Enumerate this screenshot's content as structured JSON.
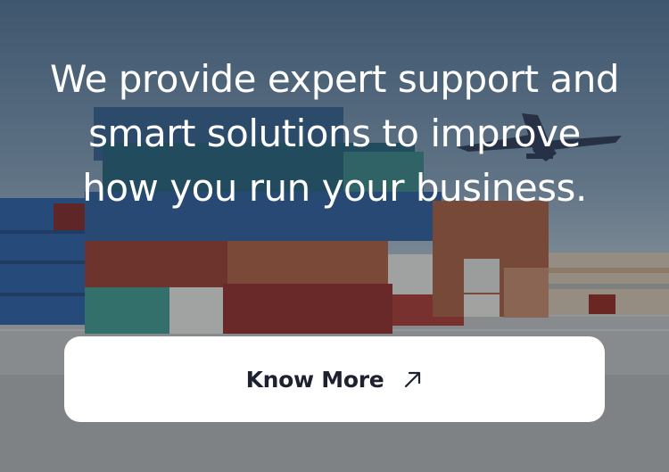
{
  "hero": {
    "headline": "We provide expert support and smart solutions to improve how you run your business.",
    "cta_label": "Know More",
    "cta_icon": "arrow-up-right-icon",
    "background_image": "shipping-containers-airplane-photo"
  },
  "colors": {
    "text": "#ffffff",
    "button_bg": "#ffffff",
    "button_text": "#1e2230"
  }
}
